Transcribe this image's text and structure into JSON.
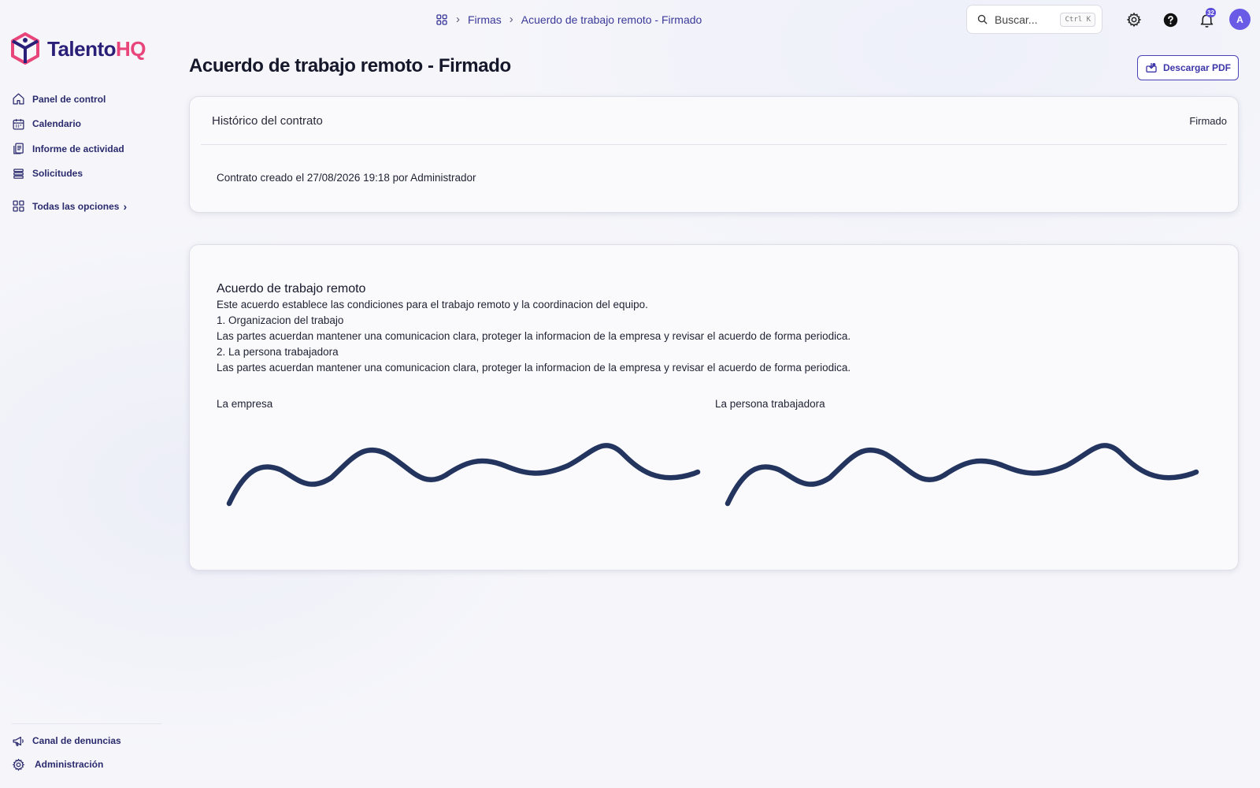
{
  "app": {
    "logo_name": "Talento",
    "logo_accent": "HQ",
    "brand_color": "#2a1f78",
    "accent_color": "#e8457a"
  },
  "sidebar": {
    "items": [
      {
        "label": "Panel de control",
        "icon": "home-icon"
      },
      {
        "label": "Calendario",
        "icon": "calendar-icon"
      },
      {
        "label": "Informe de actividad",
        "icon": "report-icon"
      },
      {
        "label": "Solicitudes",
        "icon": "list-icon"
      }
    ],
    "all_options": {
      "label": "Todas las opciones",
      "icon": "grid-icon"
    },
    "bottom": [
      {
        "label": "Canal de denuncias",
        "icon": "megaphone-icon"
      },
      {
        "label": "Administración",
        "icon": "gear-icon"
      }
    ]
  },
  "header": {
    "breadcrumb": [
      "Firmas",
      "Acuerdo de trabajo remoto - Firmado"
    ],
    "search": {
      "placeholder": "Buscar...",
      "shortcut": "Ctrl K"
    },
    "notifications_count": "32",
    "avatar_initial": "A"
  },
  "main": {
    "title": "Acuerdo de trabajo remoto - Firmado",
    "download_label": "Descargar PDF",
    "history": {
      "title": "Histórico del contrato",
      "status": "Firmado",
      "events": [
        "Contrato creado el 27/08/2026 19:18 por Administrador"
      ]
    },
    "document": {
      "title": "Acuerdo de trabajo remoto",
      "lines": [
        "Este acuerdo establece las condiciones para el trabajo remoto y la coordinacion del equipo.",
        "1. Organizacion del trabajo",
        "Las partes acuerdan mantener una comunicacion clara, proteger la informacion de la empresa y revisar el acuerdo de forma periodica.",
        "2. La persona trabajadora",
        "Las partes acuerdan mantener una comunicacion clara, proteger la informacion de la empresa y revisar el acuerdo de forma periodica."
      ],
      "signatures": [
        {
          "label": "La empresa"
        },
        {
          "label": "La persona trabajadora"
        }
      ],
      "signature_color": "#23355e"
    }
  }
}
